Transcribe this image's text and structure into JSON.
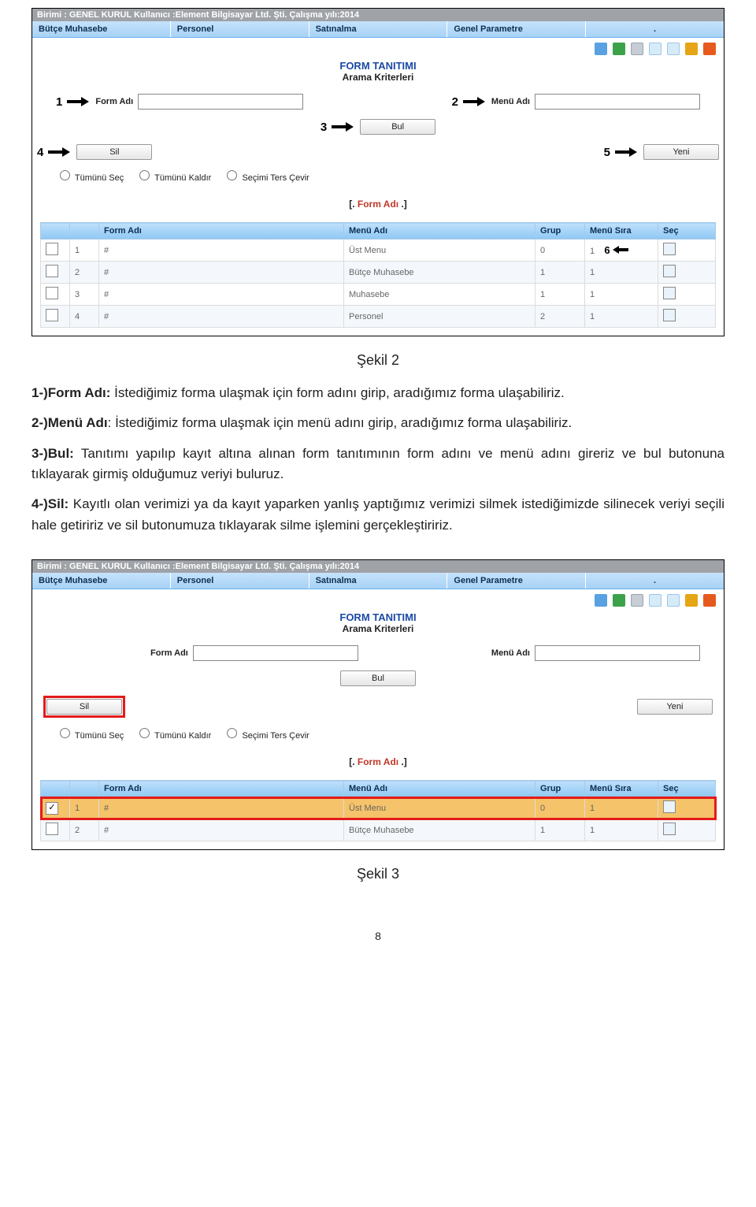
{
  "titlebar": "Birimi : GENEL KURUL   Kullanıcı :Element Bilgisayar Ltd. Şti.   Çalışma yılı:2014",
  "menu": [
    "Bütçe Muhasebe",
    "Personel",
    "Satınalma",
    "Genel Parametre",
    "."
  ],
  "hdr": {
    "title": "FORM TANITIMI",
    "sub": "Arama Kriterleri"
  },
  "labels": {
    "formAdi": "Form Adı",
    "menuAdi": "Menü Adı"
  },
  "btn": {
    "bul": "Bul",
    "sil": "Sil",
    "yeni": "Yeni"
  },
  "nums": {
    "n1": "1",
    "n2": "2",
    "n3": "3",
    "n4": "4",
    "n5": "5",
    "n6": "6"
  },
  "radios": {
    "r1": "Tümünü Seç",
    "r2": "Tümünü Kaldır",
    "r3": "Seçimi Ters Çevir"
  },
  "sort": {
    "outerL": "[. ",
    "inner": "Form Adı",
    "outerR": " .]"
  },
  "headers": {
    "h1": "",
    "h2": "",
    "h3": "Form Adı",
    "h4": "Menü Adı",
    "h5": "Grup",
    "h6": "Menü Sıra",
    "h7": "Seç"
  },
  "rows1": [
    {
      "i": "1",
      "fa": "#",
      "ma": "Üst Menu",
      "g": "0",
      "ms": "1"
    },
    {
      "i": "2",
      "fa": "#",
      "ma": "Bütçe Muhasebe",
      "g": "1",
      "ms": "1"
    },
    {
      "i": "3",
      "fa": "#",
      "ma": "Muhasebe",
      "g": "1",
      "ms": "1"
    },
    {
      "i": "4",
      "fa": "#",
      "ma": "Personel",
      "g": "2",
      "ms": "1"
    }
  ],
  "rows2": [
    {
      "i": "1",
      "fa": "#",
      "ma": "Üst Menu",
      "g": "0",
      "ms": "1"
    },
    {
      "i": "2",
      "fa": "#",
      "ma": "Bütçe Muhasebe",
      "g": "1",
      "ms": "1"
    }
  ],
  "figure2": "Şekil 2",
  "figure3": "Şekil 3",
  "p1": {
    "b": "1-)Form Adı:",
    "t": " İstediğimiz forma ulaşmak için form adını girip, aradığımız forma ulaşabiliriz."
  },
  "p2": {
    "b": "2-)Menü Adı",
    "t": ": İstediğimiz forma ulaşmak için menü adını girip, aradığımız forma ulaşabiliriz."
  },
  "p3": {
    "b": "3-)Bul:",
    "t": " Tanıtımı yapılıp kayıt altına alınan form tanıtımının form adını ve menü adını gireriz ve bul butonuna tıklayarak girmiş olduğumuz veriyi buluruz."
  },
  "p4": {
    "b": "4-)Sil:",
    "t": " Kayıtlı olan verimizi ya da kayıt yaparken yanlış yaptığımız verimizi silmek istediğimizde silinecek veriyi seçili hale getiririz ve sil butonumuza tıklayarak silme işlemini gerçekleştiririz."
  },
  "page": "8"
}
